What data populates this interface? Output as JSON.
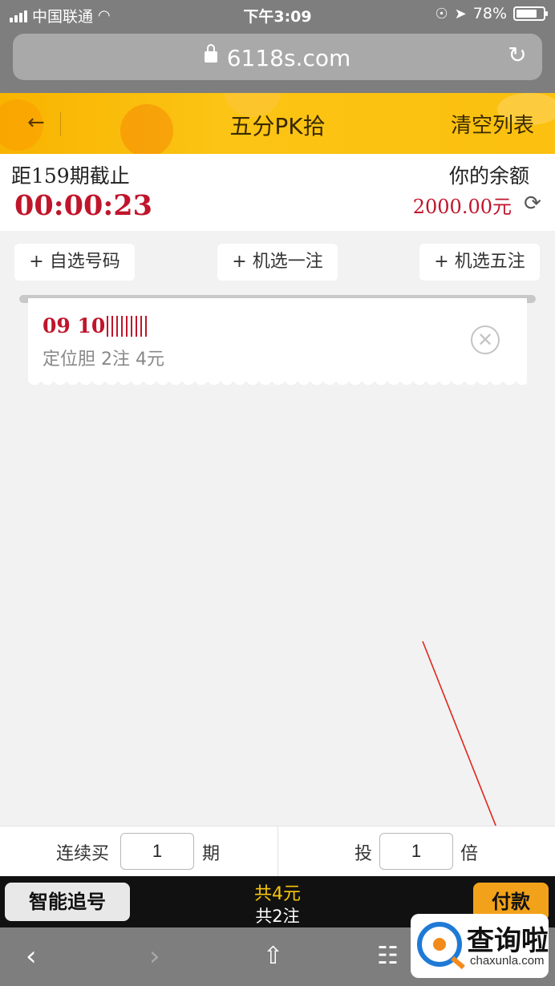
{
  "status_bar": {
    "carrier": "中国联通",
    "time": "下午3:09",
    "battery_percent": "78%",
    "battery_level": 0.78
  },
  "browser": {
    "url": "6118s.com"
  },
  "header": {
    "title": "五分PK拾",
    "clear_label": "清空列表"
  },
  "draw_info": {
    "deadline_label": "距159期截止",
    "countdown": "00:00:23",
    "balance_label": "你的余额",
    "balance_value": "2000.00元"
  },
  "actions": {
    "manual_pick": "+ 自选号码",
    "random_one": "+ 机选一注",
    "random_five": "+ 机选五注"
  },
  "bets": [
    {
      "numbers": "09 10",
      "description": "定位胆 2注 4元"
    }
  ],
  "multiplier": {
    "continuous_label": "连续买",
    "continuous_value": "1",
    "periods_label": "期",
    "bet_label": "投",
    "bet_value": "1",
    "times_label": "倍"
  },
  "paybar": {
    "smart_chase": "智能追号",
    "total_money": "共4元",
    "total_bets": "共2注",
    "pay": "付款"
  },
  "watermark": {
    "title": "查询啦",
    "subtitle": "chaxunla.com"
  },
  "colors": {
    "accent_red": "#c0152b",
    "header_orange": "#fcc414",
    "pay_orange": "#f2a21a"
  }
}
